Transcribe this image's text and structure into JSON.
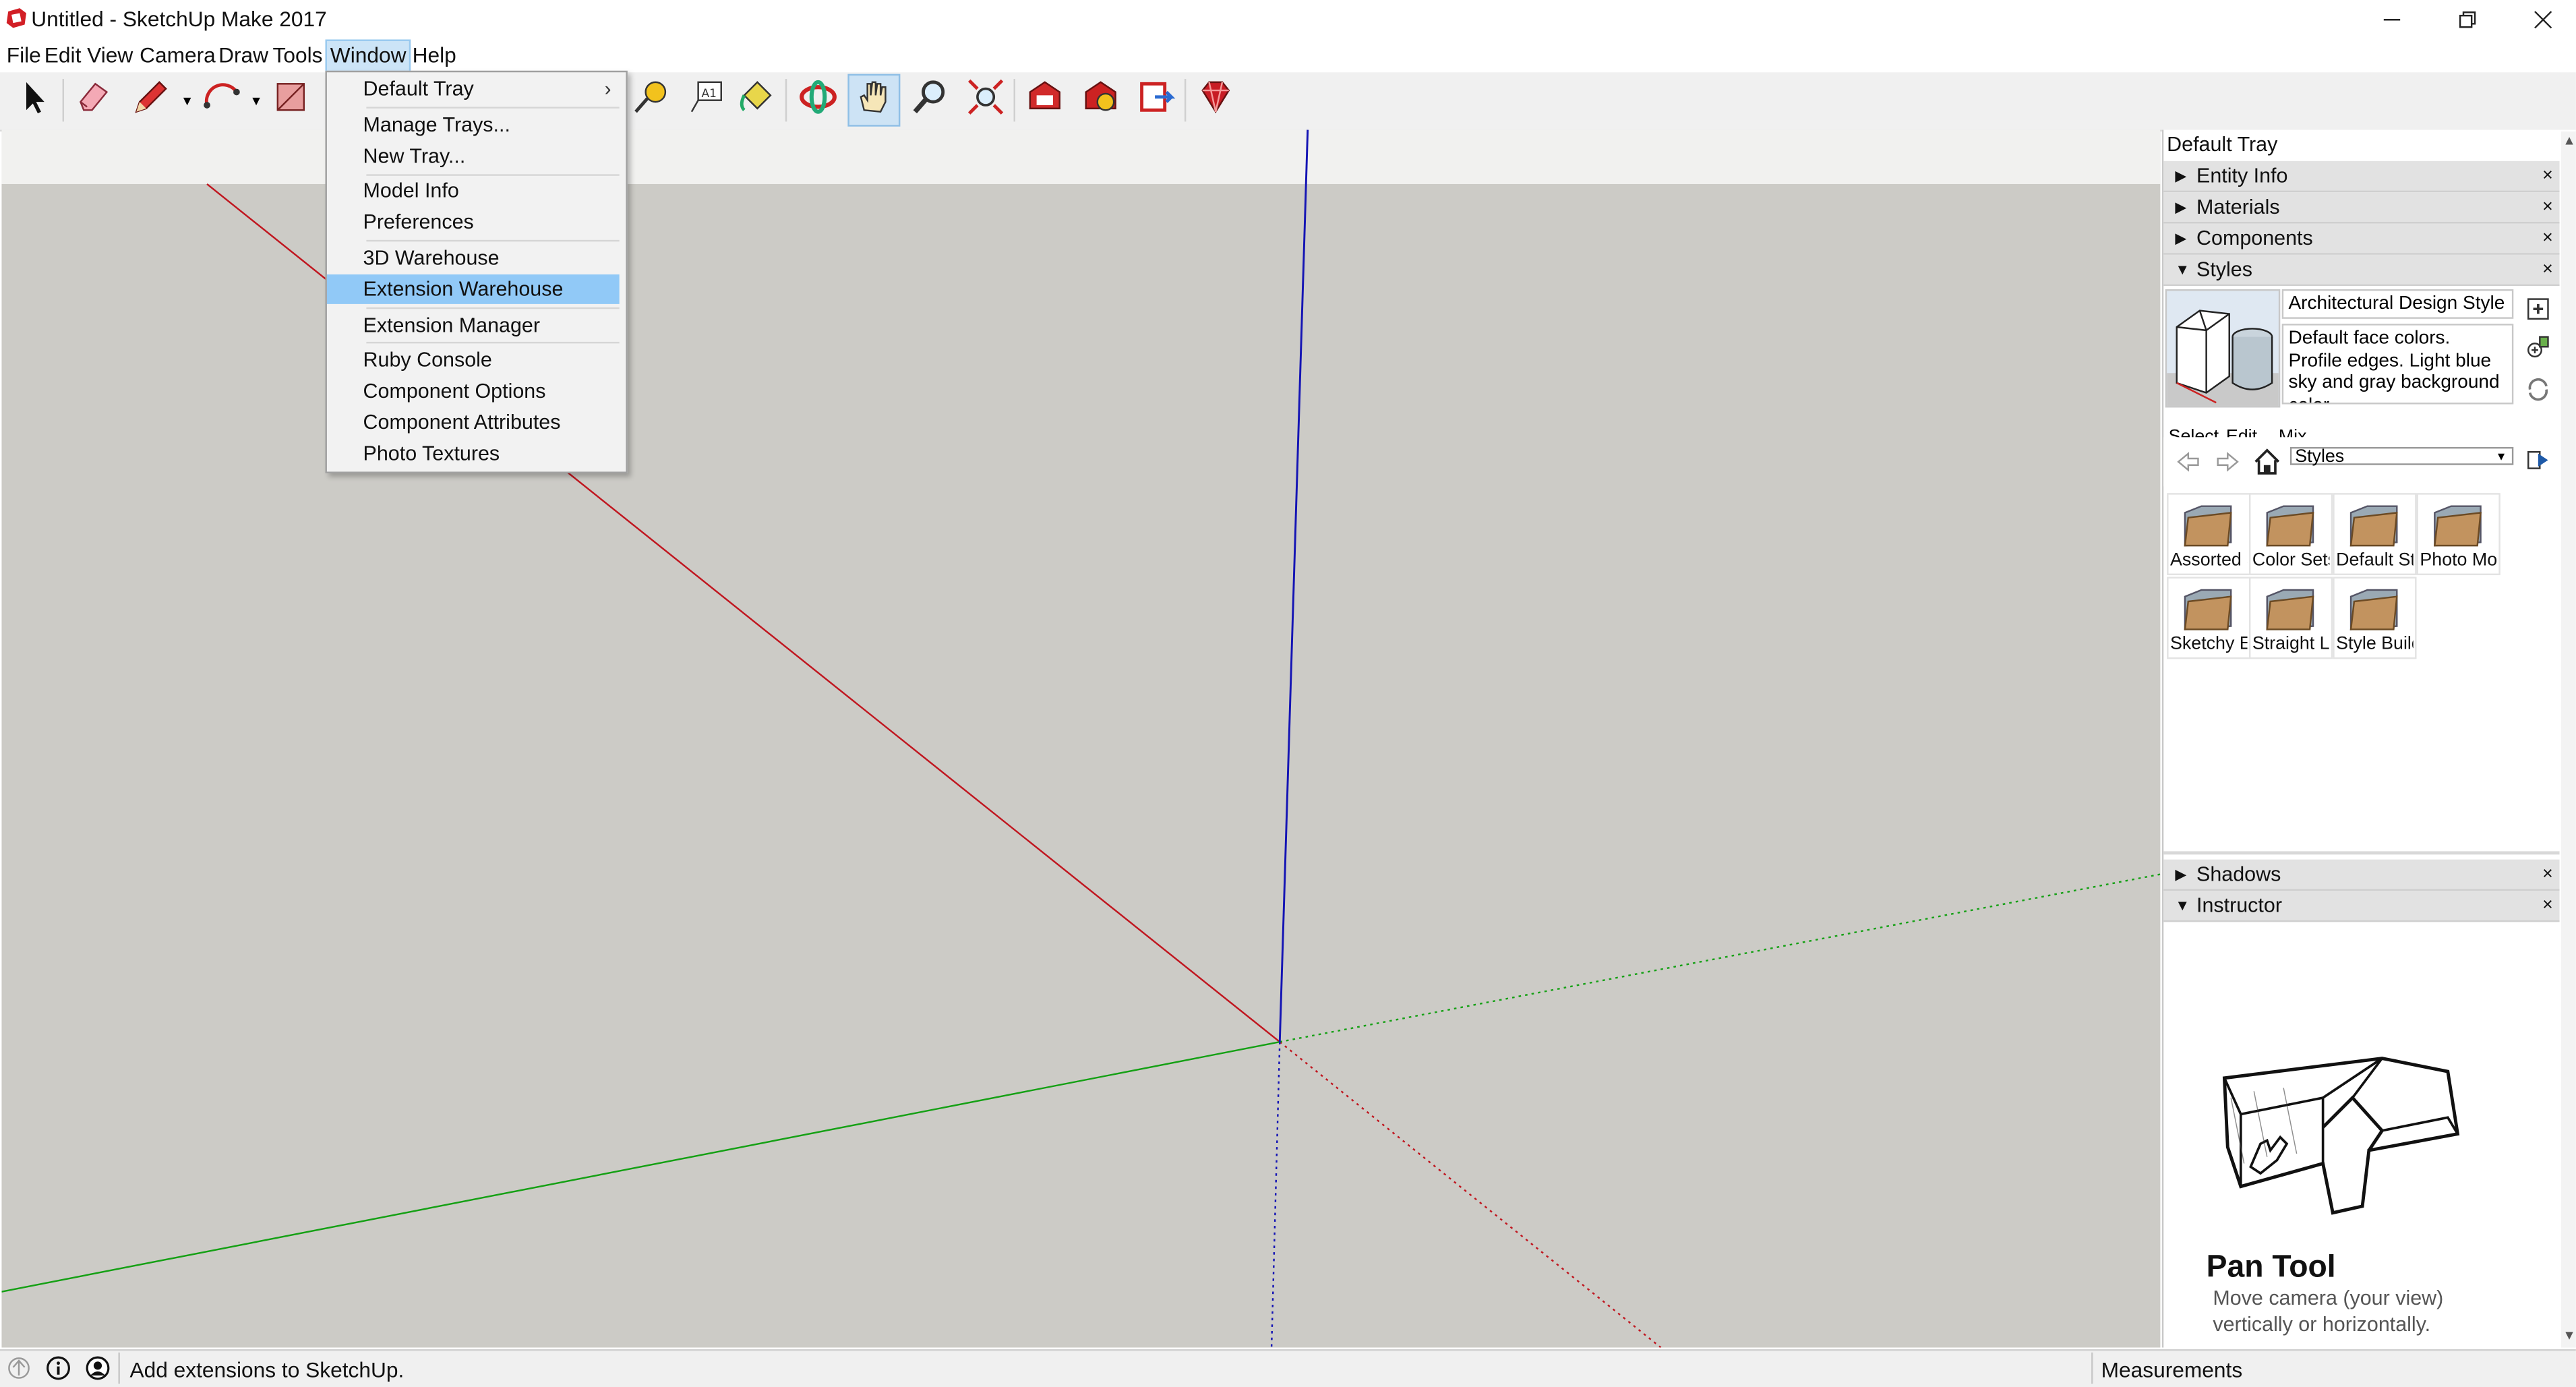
{
  "window": {
    "title": "Untitled - SketchUp Make 2017",
    "controls": [
      "minimize",
      "restore",
      "close"
    ]
  },
  "menubar": {
    "items": [
      "File",
      "Edit",
      "View",
      "Camera",
      "Draw",
      "Tools",
      "Window",
      "Help"
    ],
    "open_menu": "Window"
  },
  "window_menu": {
    "items": [
      {
        "label": "Default Tray",
        "has_submenu": true
      },
      {
        "label": "Manage Trays..."
      },
      {
        "label": "New Tray..."
      },
      {
        "label": "Model Info"
      },
      {
        "label": "Preferences"
      },
      {
        "label": "3D Warehouse"
      },
      {
        "label": "Extension Warehouse",
        "highlighted": true
      },
      {
        "label": "Extension Manager"
      },
      {
        "label": "Ruby Console"
      },
      {
        "label": "Component Options"
      },
      {
        "label": "Component Attributes"
      },
      {
        "label": "Photo Textures"
      }
    ],
    "submenu_arrow": "›"
  },
  "toolbar": {
    "tools": [
      "select-icon",
      "eraser-icon",
      "pencil-icon",
      "arc-icon",
      "rectangle-icon",
      "tape-measure-icon",
      "text-icon",
      "paint-bucket-icon",
      "orbit-icon",
      "pan-icon",
      "zoom-icon",
      "zoom-extents-icon",
      "3d-warehouse-icon",
      "extension-warehouse-icon",
      "send-to-layout-icon",
      "ruby-icon"
    ],
    "active_tool": "pan-icon"
  },
  "tray": {
    "title": "Default Tray",
    "panels": {
      "entity_info": "Entity Info",
      "materials": "Materials",
      "components": "Components",
      "styles": "Styles",
      "shadows": "Shadows",
      "instructor": "Instructor"
    },
    "close_glyph": "×",
    "expanded_arrow": "▼",
    "collapsed_arrow": "▶",
    "styles": {
      "style_name": "Architectural Design Style",
      "style_description": "Default face colors. Profile edges. Light blue sky and gray background color.",
      "tabs": [
        "Select",
        "Edit",
        "Mix"
      ],
      "library_select": "Styles",
      "folders": [
        "Assorted Styles",
        "Color Sets",
        "Default Styles",
        "Photo Modeling",
        "Sketchy Edges",
        "Straight Lines",
        "Style Builder Competition Winners"
      ]
    },
    "instructor": {
      "tool_name": "Pan Tool",
      "tool_description": "Move camera (your view) vertically or horizontally."
    }
  },
  "statusbar": {
    "message": "Add extensions to SketchUp.",
    "measurements_label": "Measurements",
    "measurements_value": ""
  },
  "colors": {
    "viewport_ground": "#cccbc6",
    "viewport_sky": "#f1f1ef",
    "menu_highlight": "#91c9f7",
    "red_axis": "#c0161f",
    "green_axis": "#14a014",
    "blue_axis": "#1414b4"
  }
}
